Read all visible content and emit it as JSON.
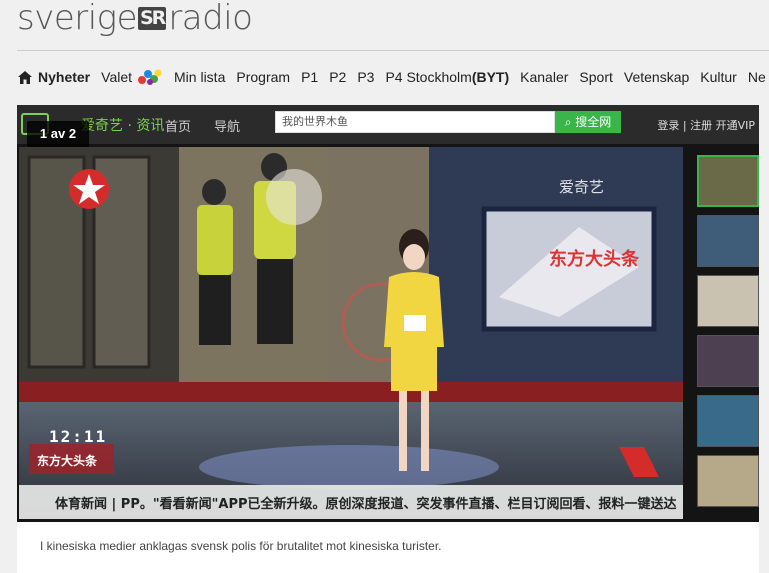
{
  "header": {
    "brand_left": "sverige",
    "brand_mark": "SR",
    "brand_right": "radio"
  },
  "nav": {
    "items": [
      {
        "label": "Nyheter"
      },
      {
        "label": "Valet"
      },
      {
        "label": "Min lista"
      },
      {
        "label": "Program"
      },
      {
        "label": "P1"
      },
      {
        "label": "P2"
      },
      {
        "label": "P3"
      },
      {
        "label": "P4 Stockholm"
      },
      {
        "label": "Kanaler"
      },
      {
        "label": "Sport"
      },
      {
        "label": "Vetenskap"
      },
      {
        "label": "Kultur"
      },
      {
        "label": "Ne"
      }
    ],
    "p4_suffix": "(BYT)"
  },
  "gallery": {
    "counter": "1 av 2"
  },
  "screenshot_ui": {
    "logo": "爱奇艺 · 资讯",
    "home": "首页",
    "nav": "导航",
    "search_placeholder": "我的世界木鱼",
    "search_button": "搜全网",
    "right_links": "登录 | 注册  开通VIP",
    "watermark": "爱奇艺",
    "clock": "12:11",
    "ticker": "体育新闻 | PP。\"看看新闻\"APP已全新升级。原创深度报道、突发事件直播、栏目订阅回看、报料一键送达"
  },
  "caption": {
    "text": "I kinesiska medier anklagas svensk polis för brutalitet mot kinesiska turister."
  },
  "colors": {
    "accent_green": "#39b54a",
    "studio_yellow": "#f2d641"
  }
}
